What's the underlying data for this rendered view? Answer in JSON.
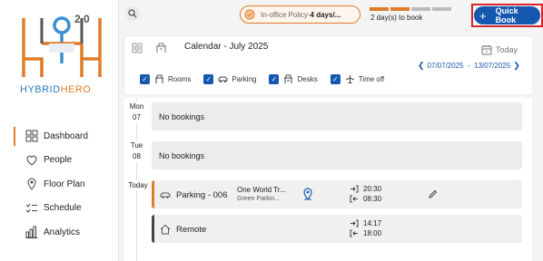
{
  "sidebar": {
    "logo": {
      "version": "2.0",
      "word_hybrid": "HYBRID",
      "word_hero": "HERO"
    },
    "items": [
      {
        "label": "Dashboard",
        "icon": "dashboard-icon",
        "active": true
      },
      {
        "label": "People",
        "icon": "people-icon",
        "active": false
      },
      {
        "label": "Floor Plan",
        "icon": "floor-plan-icon",
        "active": false
      },
      {
        "label": "Schedule",
        "icon": "schedule-icon",
        "active": false
      },
      {
        "label": "Analytics",
        "icon": "analytics-icon",
        "active": false
      }
    ]
  },
  "topbar": {
    "policy_prefix": "In-office Policy- ",
    "policy_value": "4 days/...",
    "progress_segments": [
      true,
      true,
      false,
      false
    ],
    "progress_label": "2 day(s) to book",
    "quick_book_label": "Quick Book"
  },
  "calendar": {
    "title": "Calendar - July 2025",
    "today_label": "Today",
    "range": "07/07/2025  -  13/07/2025",
    "filters": [
      {
        "label": "Rooms",
        "icon": "room-icon",
        "checked": true
      },
      {
        "label": "Parking",
        "icon": "car-icon",
        "checked": true
      },
      {
        "label": "Desks",
        "icon": "desk-icon",
        "checked": true
      },
      {
        "label": "Time off",
        "icon": "plane-icon",
        "checked": true
      }
    ]
  },
  "schedule": {
    "days": [
      {
        "dow": "Mon",
        "date": "07",
        "text": "No bookings"
      },
      {
        "dow": "Tue",
        "date": "08",
        "text": "No bookings"
      },
      {
        "dow": "Today",
        "date": ""
      }
    ],
    "bookings": [
      {
        "title": "Parking - 006",
        "location": "One World Tr...",
        "sublocation": "Green Parkin...",
        "start": "20:30",
        "end": "08:30",
        "icon": "car-icon"
      },
      {
        "title": "Remote",
        "start": "14:17",
        "end": "18:00",
        "icon": "home-icon"
      }
    ]
  },
  "colors": {
    "accent": "#e07b2a",
    "primary": "#1558b0",
    "highlight": "#d6262a"
  }
}
